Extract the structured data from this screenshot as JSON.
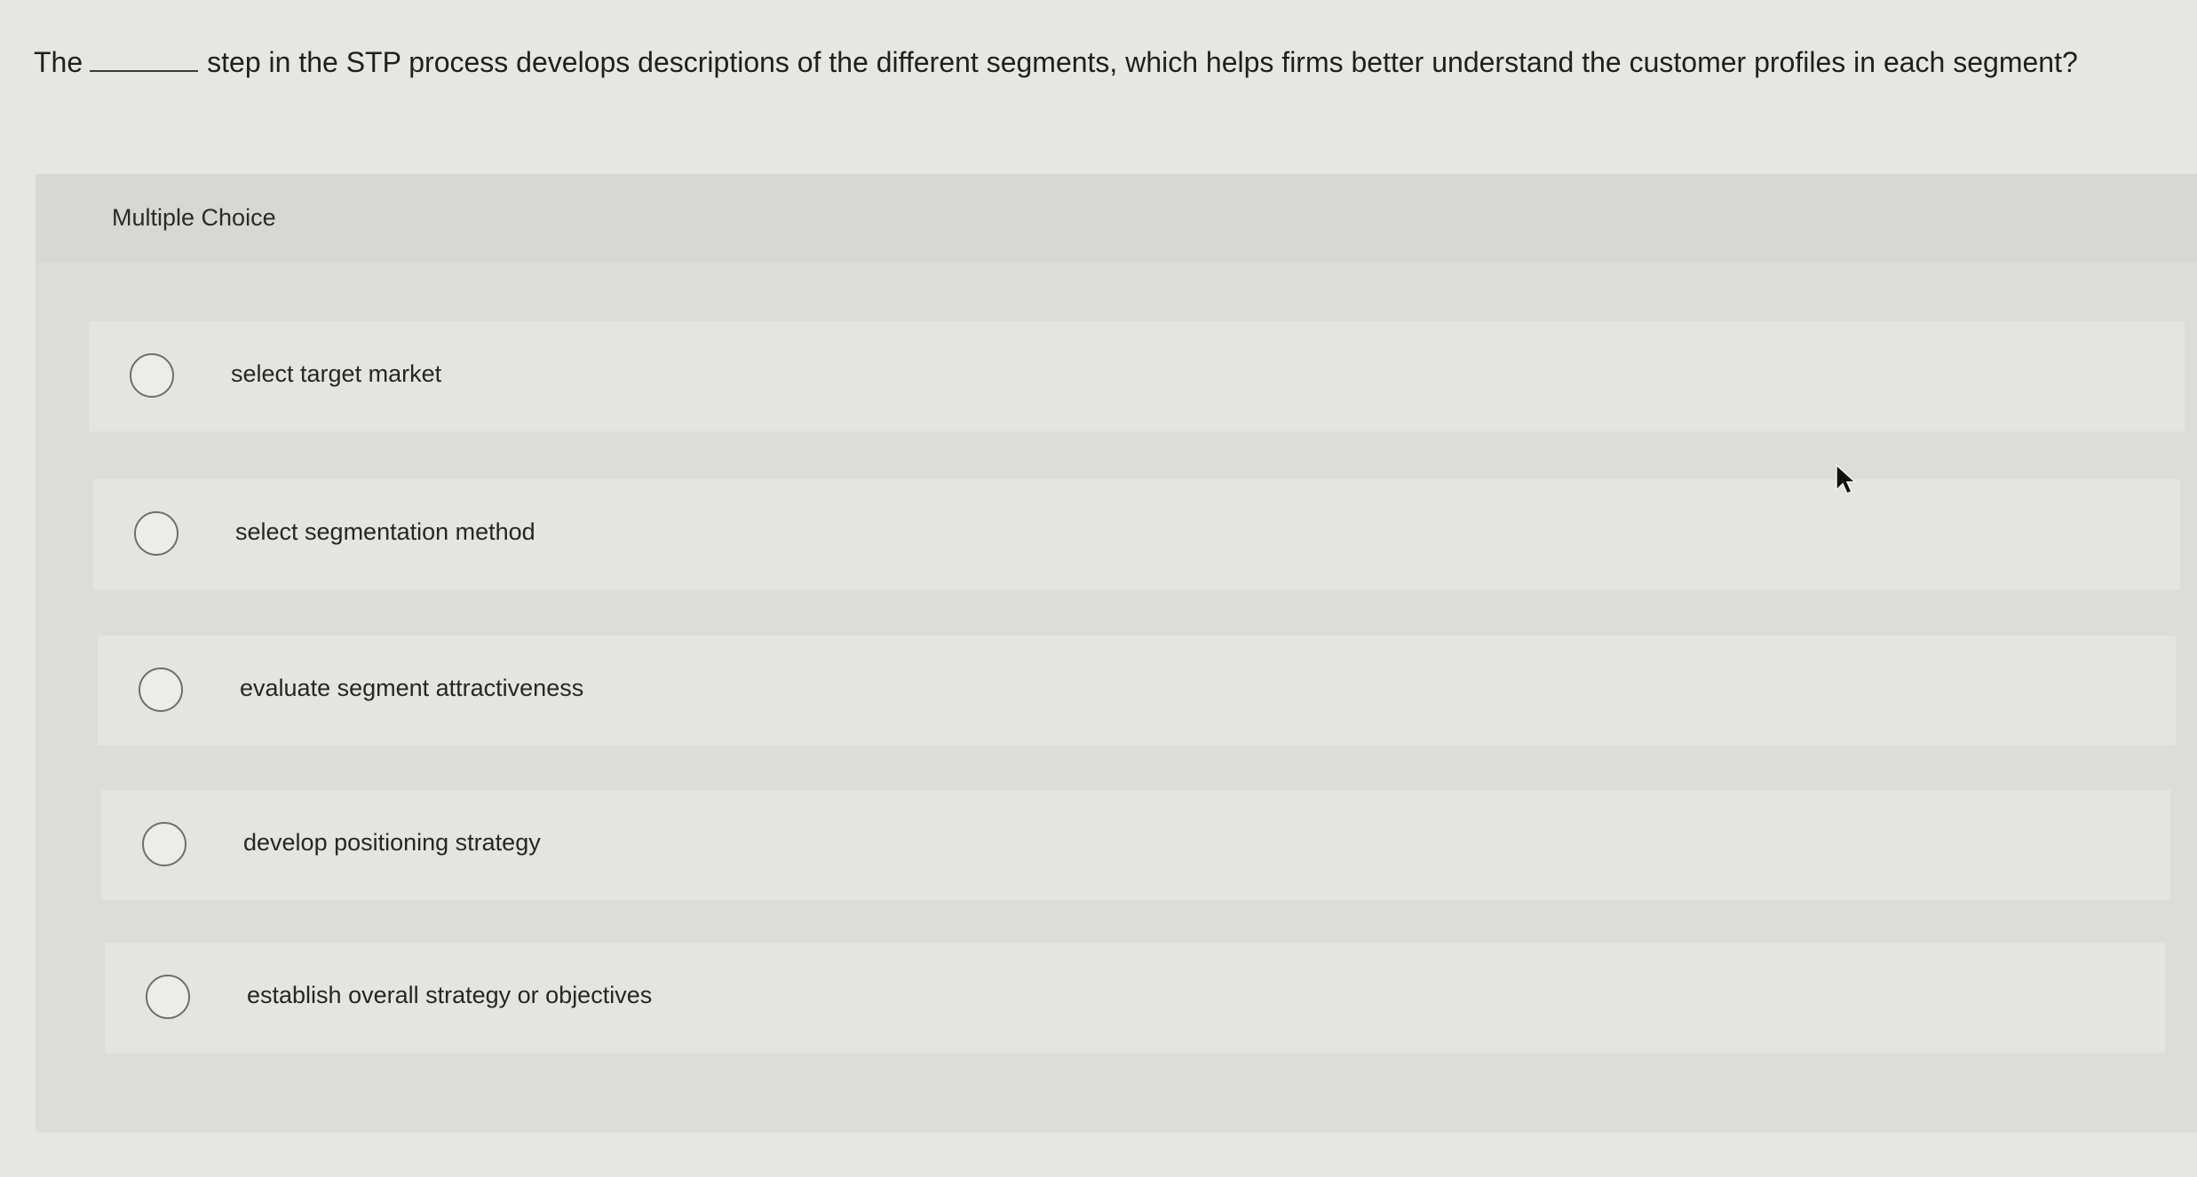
{
  "question": {
    "prefix": "The",
    "suffix": "step in the STP process develops descriptions of the different segments, which helps firms better understand the customer profiles in each segment?"
  },
  "multiple_choice": {
    "label": "Multiple Choice",
    "options": [
      {
        "label": "select target market"
      },
      {
        "label": "select segmentation method"
      },
      {
        "label": "evaluate segment attractiveness"
      },
      {
        "label": "develop positioning strategy"
      },
      {
        "label": "establish overall strategy or objectives"
      }
    ]
  },
  "icons": {
    "cursor": "mouse-pointer-icon",
    "radio": "radio-unchecked-icon"
  },
  "colors": {
    "background": "#e6e6e3",
    "panel": "#dcdcd9",
    "option_background": "#e4e4e1",
    "text": "#222222"
  }
}
